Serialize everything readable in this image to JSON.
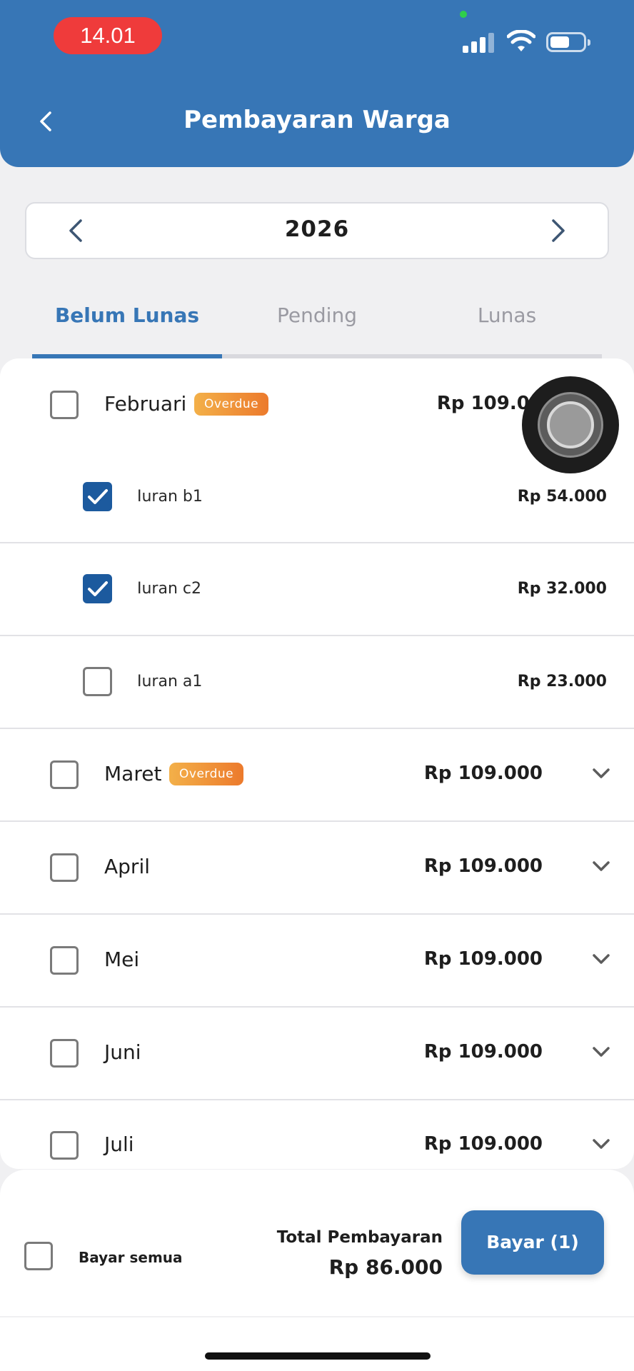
{
  "status_bar": {
    "time": "14.01"
  },
  "header": {
    "title": "Pembayaran Warga"
  },
  "year_selector": {
    "year": "2026"
  },
  "tabs": [
    {
      "label": "Belum Lunas",
      "active": true
    },
    {
      "label": "Pending",
      "active": false
    },
    {
      "label": "Lunas",
      "active": false
    }
  ],
  "months": [
    {
      "name": "Februari",
      "badge": "Overdue",
      "amount": "Rp 109.000",
      "checked": false,
      "expanded": true,
      "items": [
        {
          "name": "Iuran b1",
          "amount": "Rp 54.000",
          "checked": true
        },
        {
          "name": "Iuran c2",
          "amount": "Rp 32.000",
          "checked": true
        },
        {
          "name": "Iuran a1",
          "amount": "Rp 23.000",
          "checked": false
        }
      ]
    },
    {
      "name": "Maret",
      "badge": "Overdue",
      "amount": "Rp 109.000",
      "checked": false,
      "expanded": false
    },
    {
      "name": "April",
      "badge": "",
      "amount": "Rp 109.000",
      "checked": false,
      "expanded": false
    },
    {
      "name": "Mei",
      "badge": "",
      "amount": "Rp 109.000",
      "checked": false,
      "expanded": false
    },
    {
      "name": "Juni",
      "badge": "",
      "amount": "Rp 109.000",
      "checked": false,
      "expanded": false
    },
    {
      "name": "Juli",
      "badge": "",
      "amount": "Rp 109.000",
      "checked": false,
      "expanded": false
    }
  ],
  "footer": {
    "pay_all_label": "Bayar semua",
    "total_label": "Total Pembayaran",
    "total_value": "Rp 86.000",
    "pay_button": "Bayar (1)"
  },
  "colors": {
    "primary": "#3776b6",
    "checkbox_checked": "#1c5a9e",
    "overdue_badge": "#ec7a2c",
    "time_pill": "#ef3b3b"
  },
  "icons": {
    "back": "chevron-left-icon",
    "prev_year": "chevron-left-icon",
    "next_year": "chevron-right-icon",
    "expand": "chevron-down-icon",
    "check": "checkmark-icon"
  }
}
